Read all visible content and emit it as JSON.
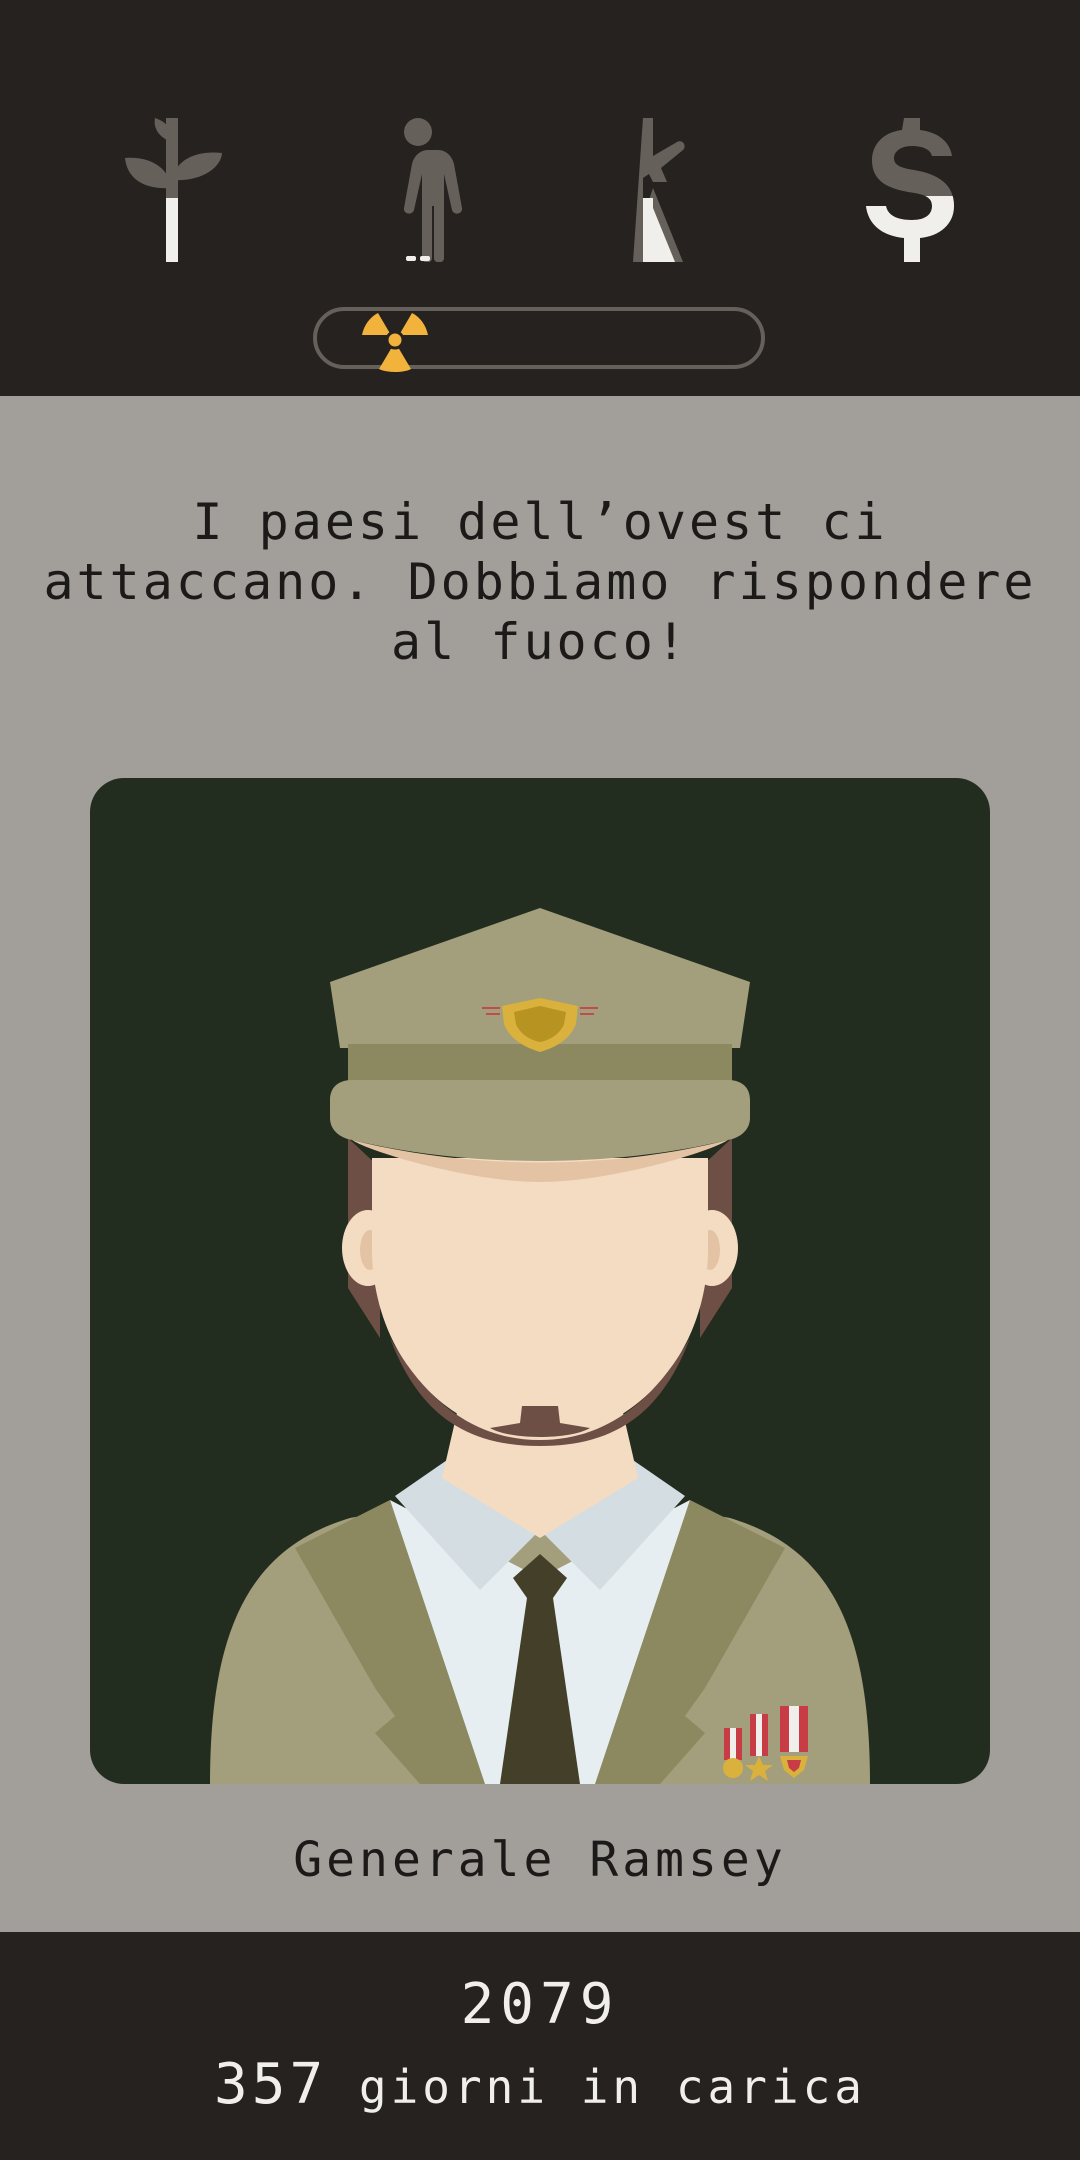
{
  "stats": [
    {
      "name": "religione",
      "icon": "leaf-plant-icon",
      "level": 0.45
    },
    {
      "name": "popolo",
      "icon": "person-icon",
      "level": 0.03
    },
    {
      "name": "esercito",
      "icon": "rifle-icon",
      "level": 0.45
    },
    {
      "name": "denaro",
      "icon": "dollar-icon",
      "level": 0.55
    }
  ],
  "nuclear_meter": {
    "icon": "radiation-icon",
    "level": 0.08,
    "accent": "#f2b33d"
  },
  "question": "I paesi dell’ovest ci attaccano. Dobbiamo rispondere al fuoco!",
  "character": {
    "name": "Generale Ramsey",
    "portrait": "general-portrait"
  },
  "footer": {
    "year": "2079",
    "days": "357",
    "days_label": "giorni in carica"
  },
  "colors": {
    "bar_bg": "#252220",
    "card_bg": "#a29e9a",
    "icon_empty": "#66605a",
    "icon_full": "#f1efec",
    "portrait_bg": "#232d1f"
  }
}
